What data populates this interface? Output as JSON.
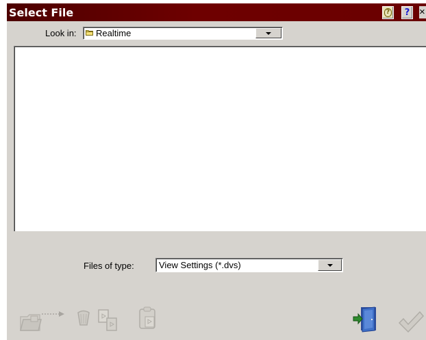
{
  "window": {
    "title": "Select File",
    "help_context_label": "?",
    "help_label": "?",
    "close_label": "×"
  },
  "look_in": {
    "label": "Look in:",
    "value": "Realtime",
    "icon": "folder-icon"
  },
  "file_list": {
    "items": []
  },
  "file_type": {
    "label": "Files of type:",
    "value": "View Settings (*.dvs)"
  },
  "toolbar": {
    "buttons": [
      {
        "name": "new-folder",
        "icon": "folder-arrow-icon",
        "enabled": false
      },
      {
        "name": "delete",
        "icon": "trash-icon",
        "enabled": false
      },
      {
        "name": "copy",
        "icon": "copy-icon",
        "enabled": false
      },
      {
        "name": "paste",
        "icon": "paste-icon",
        "enabled": false
      },
      {
        "name": "exit",
        "icon": "exit-door-icon",
        "enabled": true
      },
      {
        "name": "ok",
        "icon": "checkmark-icon",
        "enabled": false
      }
    ]
  },
  "colors": {
    "titlebar": "#6e0000",
    "dialog_bg": "#d6d3ce",
    "list_bg": "#ffffff",
    "exit_door": "#3f6fc7",
    "exit_arrow": "#2e8b2e",
    "disabled_icon": "#b9b6b0"
  }
}
